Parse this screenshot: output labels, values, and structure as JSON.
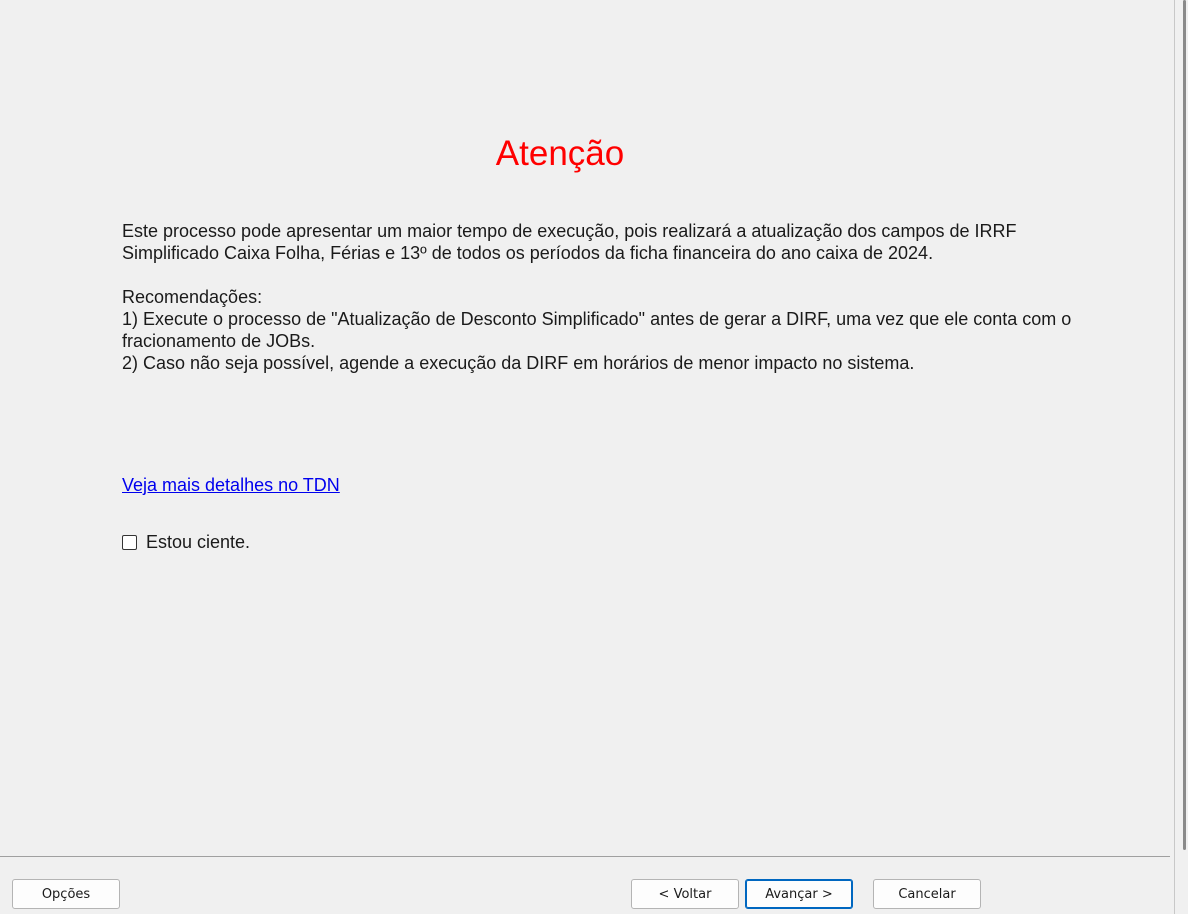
{
  "dialog": {
    "title": "Atenção",
    "paragraph1": "Este processo pode apresentar um maior tempo de execução, pois realizará a atualização dos campos de IRRF Simplificado Caixa Folha, Férias e 13º de todos os períodos da ficha financeira do ano caixa de 2024.",
    "recommendations_heading": "Recomendações:",
    "recommendation1": "1) Execute o processo de \"Atualização de Desconto Simplificado\" antes de gerar a DIRF, uma vez que ele conta com o fracionamento de JOBs.",
    "recommendation2": "2) Caso não seja possível, agende a execução da DIRF em horários de menor impacto no sistema.",
    "link_text": "Veja mais detalhes no TDN",
    "checkbox_label": "Estou ciente.",
    "checkbox_checked": false,
    "title_color": "#ff0000",
    "link_color": "#0000ee"
  },
  "footer": {
    "options_label": "Opções",
    "back_label": "< Voltar",
    "next_label": "Avançar >",
    "cancel_label": "Cancelar"
  }
}
